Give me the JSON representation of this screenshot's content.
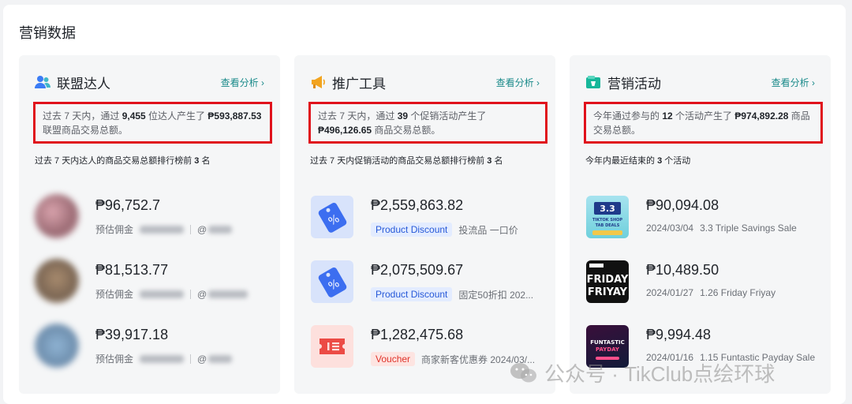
{
  "page": {
    "title": "营销数据"
  },
  "cards": [
    {
      "title": "联盟达人",
      "icon": "people-icon",
      "link": "查看分析 ›",
      "summary": {
        "p1": "过去 7 天内，通过 ",
        "b1": "9,455",
        "p2": " 位达人产生了 ",
        "b2": "₱593,887.53",
        "p3": " 联盟商品交易总额。"
      },
      "subhead": {
        "p1": "过去 7 天内达人的商品交易总额排行榜前 ",
        "b1": "3",
        "p2": " 名"
      },
      "rows": [
        {
          "amount": "₱96,752.7",
          "label": "预估佣金",
          "handle": "@"
        },
        {
          "amount": "₱81,513.77",
          "label": "预估佣金",
          "handle": "@"
        },
        {
          "amount": "₱39,917.18",
          "label": "预估佣金",
          "handle": "@"
        }
      ]
    },
    {
      "title": "推广工具",
      "icon": "megaphone-icon",
      "link": "查看分析 ›",
      "summary": {
        "p1": "过去 7 天内，通过 ",
        "b1": "39",
        "p2": " 个促销活动产生了 ",
        "b2": "₱496,126.65",
        "p3": " 商品交易总额。"
      },
      "subhead": {
        "p1": "过去 7 天内促销活动的商品交易总额排行榜前 ",
        "b1": "3",
        "p2": " 名"
      },
      "rows": [
        {
          "amount": "₱2,559,863.82",
          "tag": "Product Discount",
          "desc": "投流品 一口价"
        },
        {
          "amount": "₱2,075,509.67",
          "tag": "Product Discount",
          "desc": "固定50折扣 202..."
        },
        {
          "amount": "₱1,282,475.68",
          "tag": "Voucher",
          "desc": "商家新客优惠券 2024/03/..."
        }
      ]
    },
    {
      "title": "营销活动",
      "icon": "campaign-icon",
      "link": "查看分析 ›",
      "summary": {
        "p1": "今年通过参与的 ",
        "b1": "12",
        "p2": " 个活动产生了 ",
        "b2": "₱974,892.28",
        "p3": " 商品交易总额。"
      },
      "subhead": {
        "p1": "今年内最近结束的 ",
        "b1": "3",
        "p2": " 个活动"
      },
      "rows": [
        {
          "amount": "₱90,094.08",
          "date": "2024/03/04",
          "name": "3.3 Triple Savings Sale",
          "thumb": {
            "line1": "3.3",
            "line2": "TIKTOK SHOP",
            "line3": "TAB DEALS"
          }
        },
        {
          "amount": "₱10,489.50",
          "date": "2024/01/27",
          "name": "1.26 Friday Friyay",
          "thumb": {
            "line1": "FRIDAY",
            "line2": "FRIYAY"
          }
        },
        {
          "amount": "₱9,994.48",
          "date": "2024/01/16",
          "name": "1.15 Funtastic Payday Sale",
          "thumb": {
            "line1": "FUNTASTIC",
            "line2": "PAYDAY"
          }
        }
      ]
    }
  ],
  "watermark": {
    "text": "公众号 · TikClub点绘环球"
  },
  "colors": {
    "accent": "#1a8a8a",
    "highlight_border": "#e0121c",
    "tag_blue": "#2759d8",
    "tag_red": "#e0332a"
  }
}
